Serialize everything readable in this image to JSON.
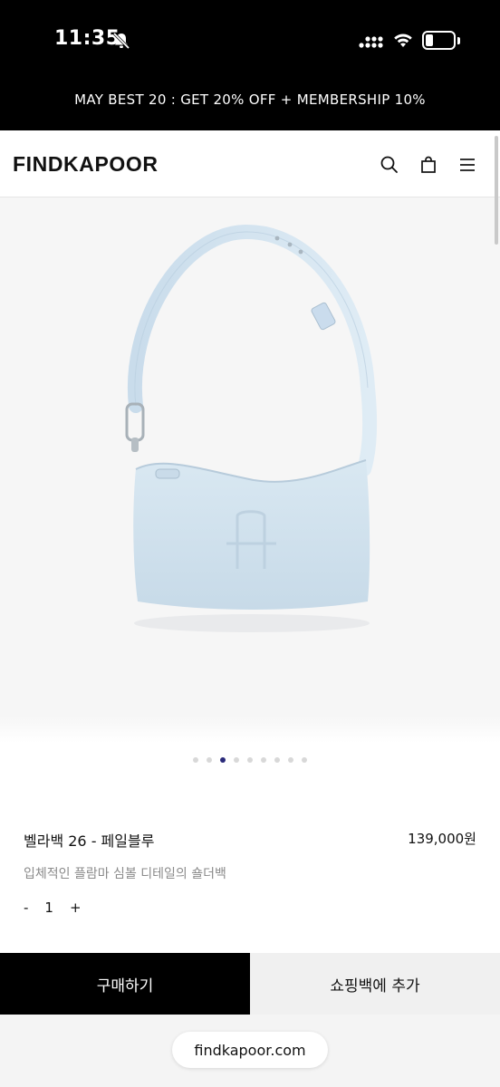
{
  "status_bar": {
    "time": "11:35"
  },
  "promo": {
    "text": "MAY BEST 20 : GET 20% OFF + MEMBERSHIP 10%"
  },
  "header": {
    "logo": "FINDKAPOOR",
    "icons": [
      "search-icon",
      "shopping-bag-icon",
      "menu-icon"
    ]
  },
  "gallery": {
    "slide_count": 9,
    "active_slide": 3,
    "bag_color": "#cfe0ec"
  },
  "product": {
    "name": "벨라백 26 - 페일블루",
    "price": "139,000원",
    "description": "입체적인 플람마 심볼 디테일의 숄더백",
    "quantity": {
      "minus": "-",
      "value": "1",
      "plus": "+"
    }
  },
  "actions": {
    "buy": "구매하기",
    "add_to_cart": "쇼핑백에 추가"
  },
  "browser": {
    "url": "findkapoor.com"
  }
}
